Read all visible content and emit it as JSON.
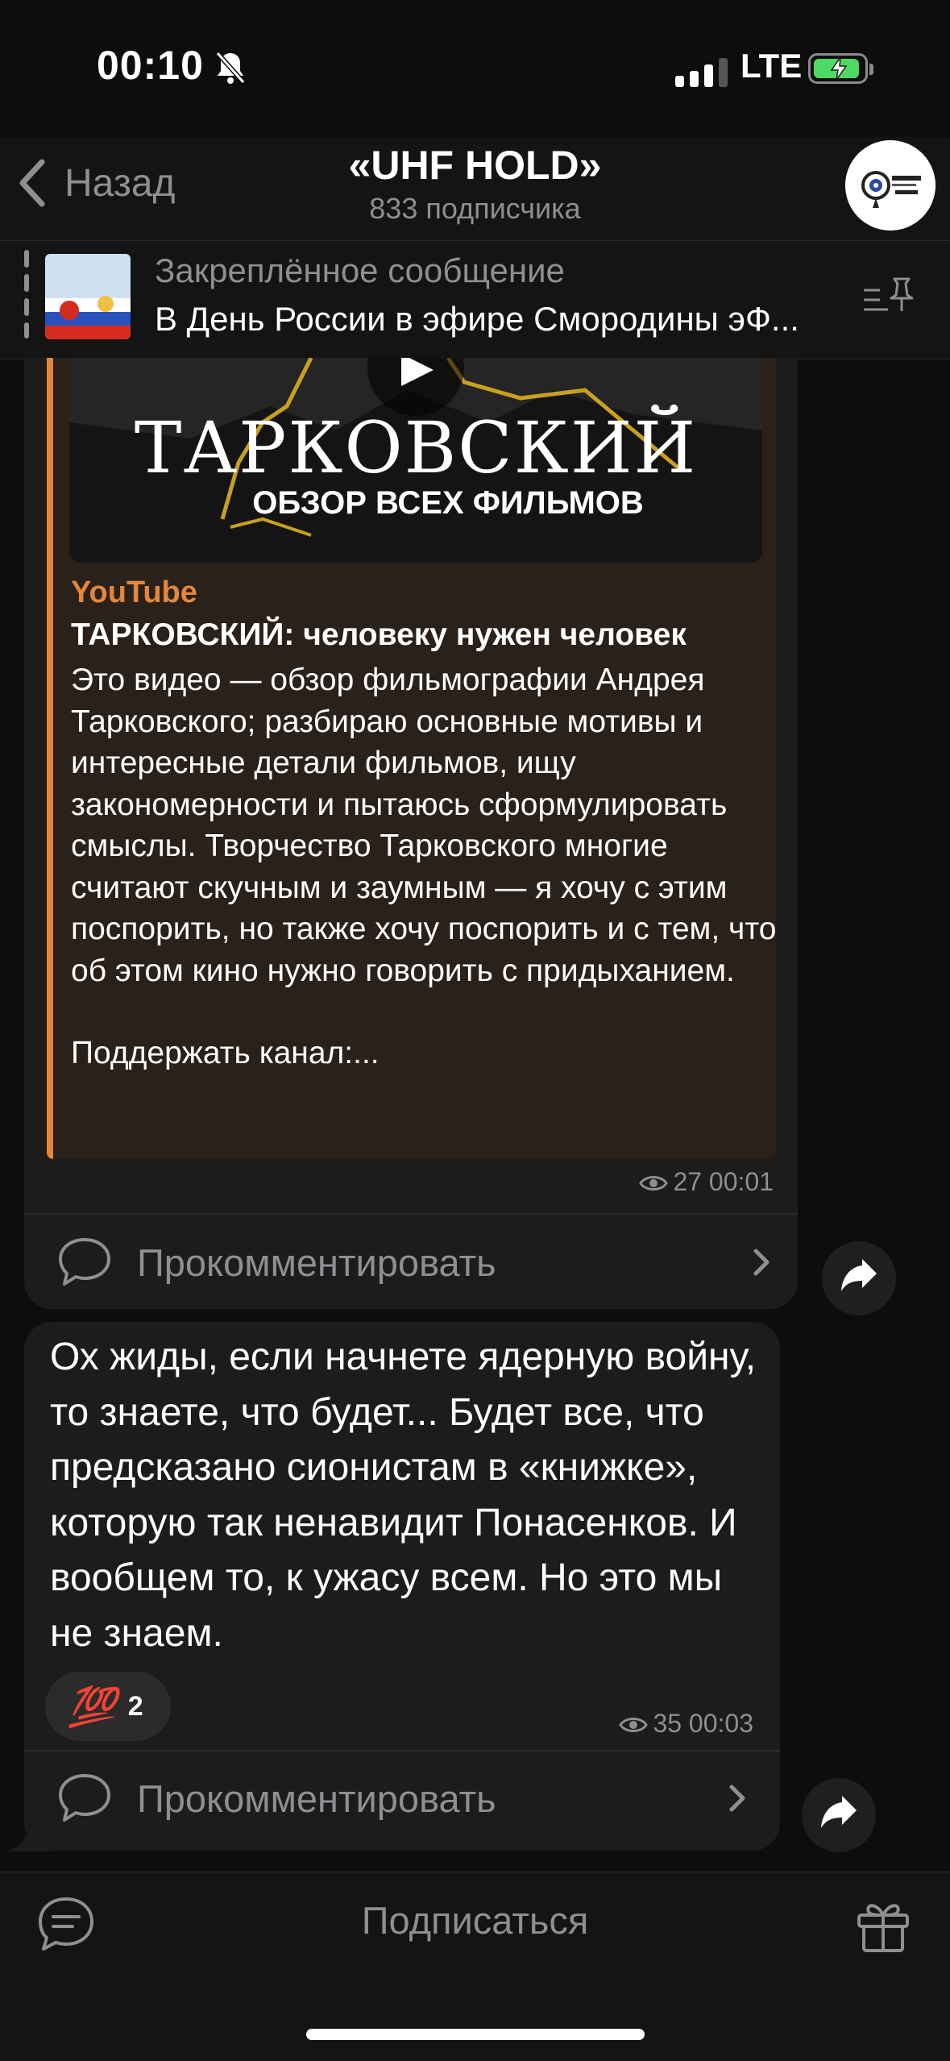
{
  "status_bar": {
    "time": "00:10",
    "carrier": "LTE",
    "colors": {
      "battery": "#4cd964"
    }
  },
  "header": {
    "back_label": "Назад",
    "channel_title": "«UHF HOLD»",
    "subscribers": "833 подписчика",
    "avatar_icon": "uhf-hold-logo"
  },
  "pinned": {
    "label": "Закреплённое сообщение",
    "text": "В День России в эфире Смородины эФ..."
  },
  "post1": {
    "thumbnail_title": "ТАРКОВСКИЙ",
    "thumbnail_subtitle": "ОБЗОР ВСЕХ ФИЛЬМОВ",
    "site": "YouTube",
    "title": "ТАРКОВСКИЙ: человеку нужен человек",
    "description": "Это видео — обзор фильмографии Андрея Тарковского; разбираю основные мотивы и интересные детали фильмов, ищу закономерности и пытаюсь сформулировать смыслы. Творчество Тарковского многие считают скучным и заумным — я хочу с этим поспорить, но также хочу поспорить и с тем, что об этом кино нужно говорить с придыханием.",
    "support": "Поддержать канал:...",
    "views": "27",
    "time": "00:01",
    "comment_label": "Прокомментировать"
  },
  "post2": {
    "text": "Ох жиды, если начнете ядерную войну, то знаете, что будет... Будет все, что предсказано сионистам в «книжке», которую так ненавидит Понасенков. И вообщем то, к ужасу всем. Но это мы не знаем.",
    "reaction_emoji": "💯",
    "reaction_count": "2",
    "views": "35",
    "time": "00:03",
    "comment_label": "Прокомментировать"
  },
  "footer": {
    "subscribe_label": "Подписаться"
  },
  "colors": {
    "accent": "#e4873b",
    "bubble": "#1c1c1c",
    "muted": "#8e8e93"
  }
}
